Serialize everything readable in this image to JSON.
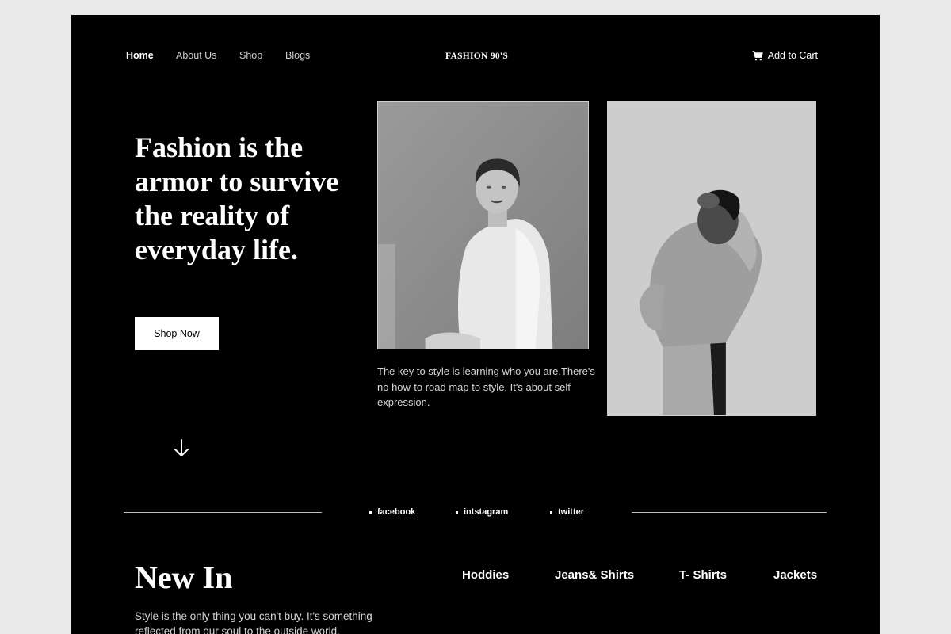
{
  "nav": {
    "links": [
      {
        "label": "Home",
        "active": true
      },
      {
        "label": "About Us",
        "active": false
      },
      {
        "label": "Shop",
        "active": false
      },
      {
        "label": "Blogs",
        "active": false
      }
    ],
    "brand": "FASHION 90'S",
    "cart": {
      "label": "Add to Cart",
      "icon": "cart-icon"
    }
  },
  "hero": {
    "title": "Fashion is the armor to survive the reality of everyday life.",
    "cta_label": "Shop Now",
    "scroll_icon": "arrow-down-icon",
    "tagline": "The key to style is learning who you are.There's no how-to road map to style. It's about self expression."
  },
  "social": {
    "links": [
      "facebook",
      "intstagram",
      "twitter"
    ]
  },
  "new_in": {
    "title": "New In",
    "description": "Style is the only thing you can't buy. It's something reflected from our soul to the outside world.",
    "categories": [
      "Hoddies",
      "Jeans& Shirts",
      "T- Shirts",
      "Jackets"
    ]
  },
  "colors": {
    "page_bg": "#000000",
    "outer_bg": "#e9e9e9",
    "text": "#ffffff",
    "muted_text": "#d6d6d6",
    "button_bg": "#ffffff",
    "button_text": "#000000"
  }
}
